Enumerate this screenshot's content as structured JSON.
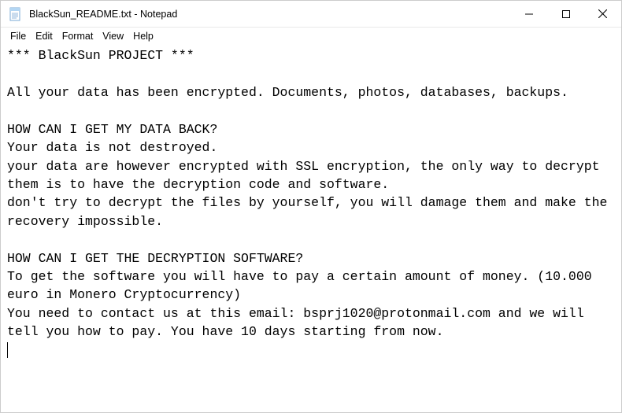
{
  "window": {
    "title": "BlackSun_README.txt - Notepad",
    "icon": "notepad-icon"
  },
  "menubar": {
    "file": "File",
    "edit": "Edit",
    "format": "Format",
    "view": "View",
    "help": "Help"
  },
  "content": {
    "text": "*** BlackSun PROJECT ***\n\nAll your data has been encrypted. Documents, photos, databases, backups.\n\nHOW CAN I GET MY DATA BACK?\nYour data is not destroyed.\nyour data are however encrypted with SSL encryption, the only way to decrypt them is to have the decryption code and software.\ndon't try to decrypt the files by yourself, you will damage them and make the recovery impossible.\n\nHOW CAN I GET THE DECRYPTION SOFTWARE?\nTo get the software you will have to pay a certain amount of money. (10.000 euro in Monero Cryptocurrency)\nYou need to contact us at this email: bsprj1020@protonmail.com and we will tell you how to pay. You have 10 days starting from now."
  }
}
